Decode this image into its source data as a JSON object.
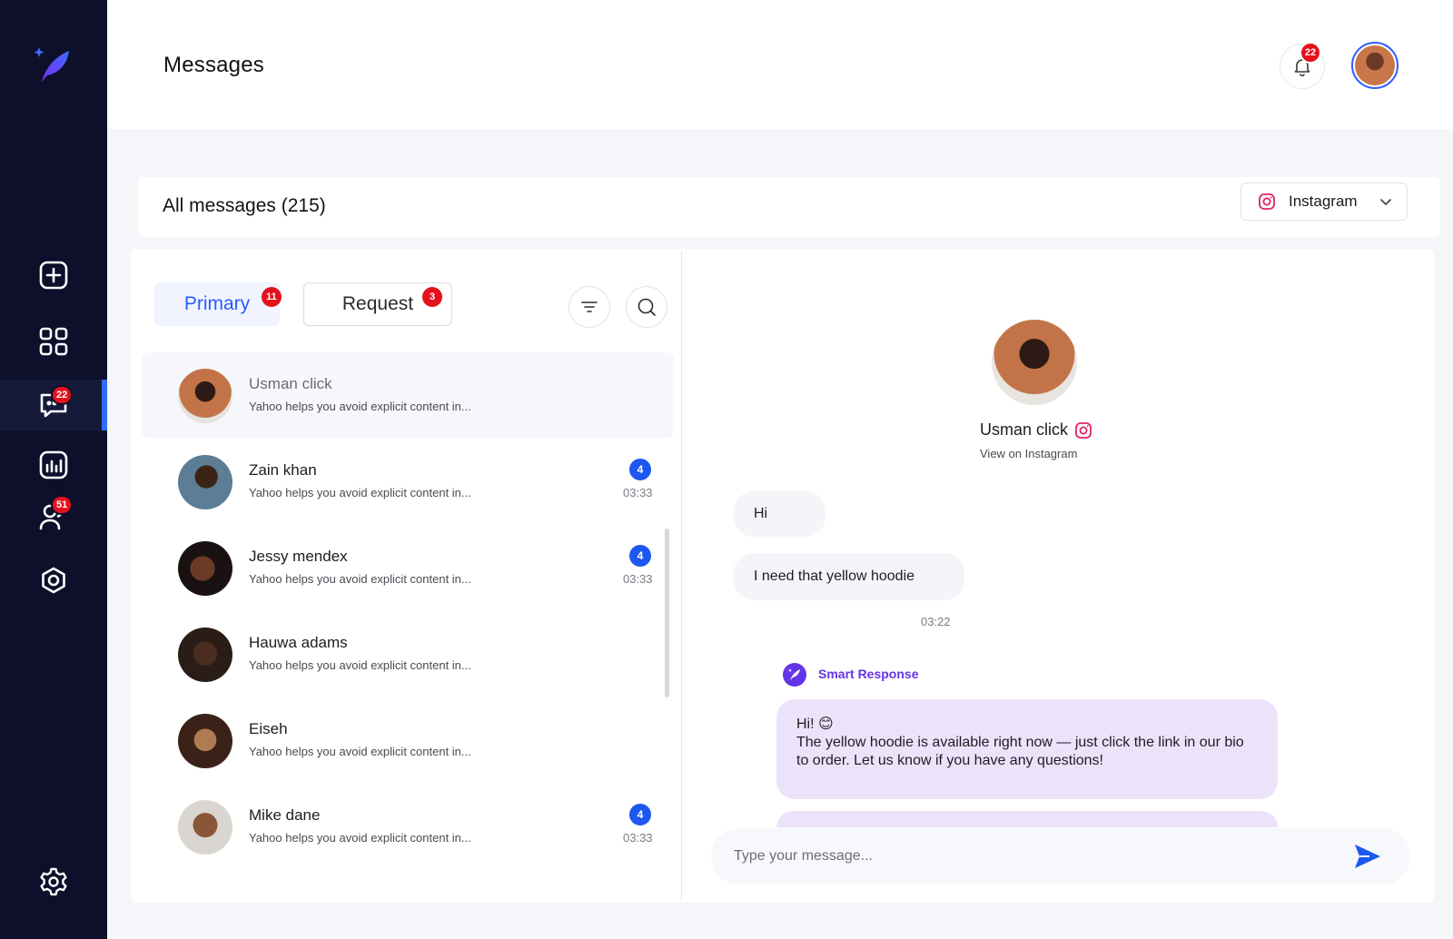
{
  "header": {
    "title": "Messages",
    "notification_count": "22"
  },
  "sidebar": {
    "items": [
      {
        "name": "create",
        "badge": ""
      },
      {
        "name": "dashboard",
        "badge": ""
      },
      {
        "name": "messages",
        "badge": "22"
      },
      {
        "name": "analytics",
        "badge": ""
      },
      {
        "name": "audience",
        "badge": "51"
      },
      {
        "name": "automation",
        "badge": ""
      },
      {
        "name": "settings",
        "badge": ""
      }
    ]
  },
  "inbox": {
    "title": "All messages (215)",
    "platform": "Instagram",
    "tabs": [
      {
        "label": "Primary",
        "badge": "11"
      },
      {
        "label": "Request",
        "badge": "3"
      }
    ],
    "conversations": [
      {
        "name": "Usman click",
        "preview": "Yahoo helps you avoid explicit content in...",
        "count": "",
        "time": ""
      },
      {
        "name": "Zain khan",
        "preview": "Yahoo helps you avoid explicit content in...",
        "count": "4",
        "time": "03:33"
      },
      {
        "name": "Jessy mendex",
        "preview": "Yahoo helps you avoid explicit content in...",
        "count": "4",
        "time": "03:33"
      },
      {
        "name": "Hauwa adams",
        "preview": "Yahoo helps you avoid explicit content in...",
        "count": "",
        "time": ""
      },
      {
        "name": "Eiseh",
        "preview": "Yahoo helps you avoid explicit content in...",
        "count": "",
        "time": ""
      },
      {
        "name": "Mike dane",
        "preview": "Yahoo helps you avoid explicit content in...",
        "count": "4",
        "time": "03:33"
      }
    ]
  },
  "chat": {
    "contact_name": "Usman click",
    "view_link": "View on Instagram",
    "messages": [
      {
        "text": "Hi"
      },
      {
        "text": "I need that yellow hoodie"
      }
    ],
    "time": "03:22",
    "smart_label": "Smart Response",
    "smart_reply_line1": "Hi! 😊",
    "smart_reply_line2": "The yellow hoodie is available right now — just click the link in our bio to order. Let us know if you have any questions!",
    "input_placeholder": "Type your message..."
  },
  "colors": {
    "sidebar_bg": "#0d0f2b",
    "accent": "#2a5bff",
    "badge_red": "#e4111c",
    "count_blue": "#1c57f0",
    "smart_purple": "#6434e8",
    "smart_bubble": "#ece3fb"
  }
}
